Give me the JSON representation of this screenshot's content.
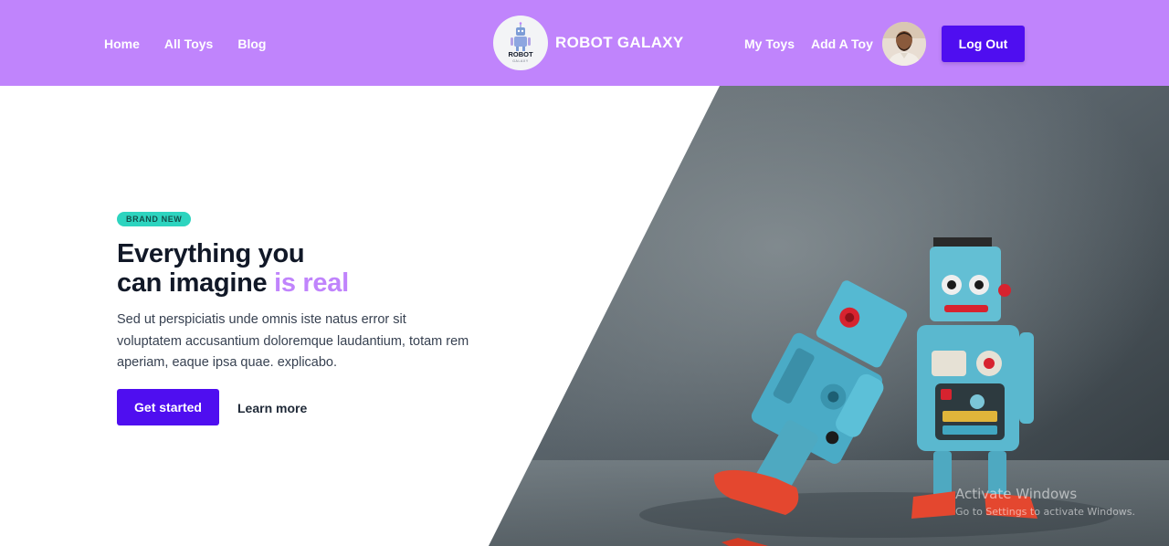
{
  "navbar": {
    "links_left": [
      "Home",
      "All Toys",
      "Blog"
    ],
    "brand": {
      "logo_text": "ROBOT",
      "logo_subtext": "GALAXY",
      "name": "ROBOT GALAXY"
    },
    "links_right": [
      "My Toys",
      "Add A Toy"
    ],
    "logout_label": "Log Out",
    "avatar_alt": "user avatar",
    "background_color": "#c084fc"
  },
  "hero": {
    "badge": "BRAND NEW",
    "headline_line1": "Everything you",
    "headline_line2_main": "can imagine ",
    "headline_line2_accent": "is real",
    "description": "Sed ut perspiciatis unde omnis iste natus error sit voluptatem accusantium doloremque laudantium, totam rem aperiam, eaque ipsa quae. explicabo.",
    "primary_button": "Get started",
    "secondary_link": "Learn more",
    "image": "two-blue-tin-robots",
    "accent_color": "#c084fc",
    "button_color": "#4f0ef0"
  },
  "watermark": {
    "title": "Activate Windows",
    "subtitle": "Go to Settings to activate Windows."
  }
}
